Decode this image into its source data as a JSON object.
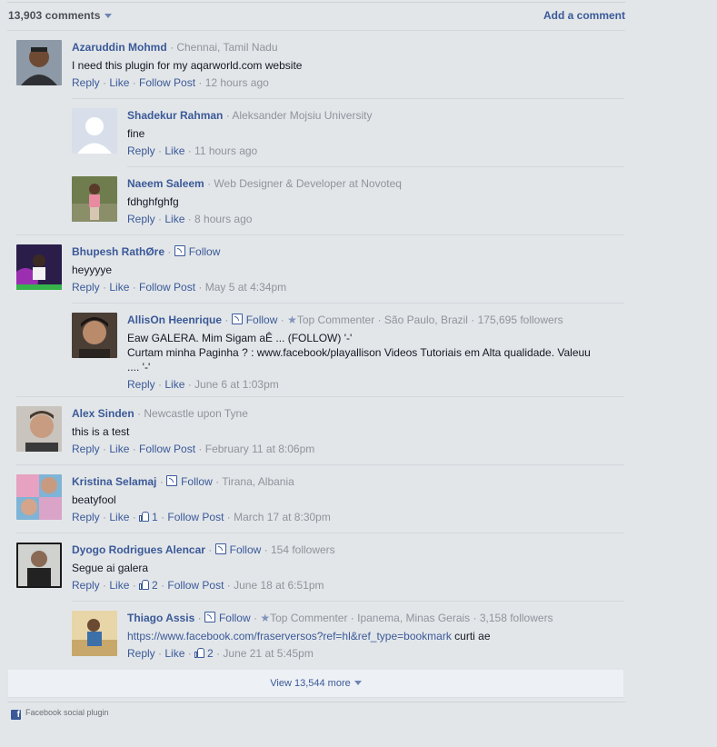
{
  "header": {
    "count": "13,903 comments",
    "add_comment": "Add a comment"
  },
  "comments": [
    {
      "name": "Azaruddin Mohmd",
      "meta": "· Chennai, Tamil Nadu",
      "text": "I need this plugin for my aqarworld.com website",
      "reply": "Reply",
      "like": "Like",
      "follow_post": "Follow Post",
      "time": "12 hours ago"
    },
    {
      "name": "Shadekur Rahman",
      "meta": "· Aleksander Mojsiu University",
      "text": "fine",
      "reply": "Reply",
      "like": "Like",
      "time": "11 hours ago"
    },
    {
      "name": "Naeem Saleem",
      "meta": "· Web Designer & Developer at Novoteq",
      "text": "fdhghfghfg",
      "reply": "Reply",
      "like": "Like",
      "time": "8 hours ago"
    },
    {
      "name": "Bhupesh RathØre",
      "follow": "Follow",
      "text": "heyyyye",
      "reply": "Reply",
      "like": "Like",
      "follow_post": "Follow Post",
      "time": "May 5 at 4:34pm"
    },
    {
      "name": "AllisOn Heenrique",
      "follow": "Follow",
      "badge": "Top Commenter",
      "meta": "· São Paulo, Brazil · 175,695 followers",
      "text1": "Eaw GALERA. Mim Sigam aÊ ... (FOLLOW) '-'",
      "text2": "Curtam minha Paginha ? : www.facebook/playallison Videos Tutoriais em Alta qualidade. Valeuu",
      "text3": ".... '-'",
      "reply": "Reply",
      "like": "Like",
      "time": "June 6 at 1:03pm"
    },
    {
      "name": "Alex Sinden",
      "meta": "· Newcastle upon Tyne",
      "text": "this is a test",
      "reply": "Reply",
      "like": "Like",
      "follow_post": "Follow Post",
      "time": "February 11 at 8:06pm"
    },
    {
      "name": "Kristina Selamaj",
      "follow": "Follow",
      "meta": "· Tirana, Albania",
      "text": "beatyfool",
      "reply": "Reply",
      "like": "Like",
      "likes": "1",
      "follow_post": "Follow Post",
      "time": "March 17 at 8:30pm"
    },
    {
      "name": "Dyogo Rodrigues Alencar",
      "follow": "Follow",
      "meta": "· 154 followers",
      "text": "Segue ai galera",
      "reply": "Reply",
      "like": "Like",
      "likes": "2",
      "follow_post": "Follow Post",
      "time": "June 18 at 6:51pm"
    },
    {
      "name": "Thiago Assis",
      "follow": "Follow",
      "badge": "Top Commenter",
      "meta": "· Ipanema, Minas Gerais · 3,158 followers",
      "link": "https://www.facebook.com/fraserversos?ref=hl&ref_type=bookmark",
      "text_after": " curti ae",
      "reply": "Reply",
      "like": "Like",
      "likes": "2",
      "time": "June 21 at 5:45pm"
    }
  ],
  "view_more": "View 13,544 more",
  "footer": "Facebook social plugin",
  "colors": {
    "link": "#3b5998",
    "meta": "#90949c",
    "background": "#e2e6e9"
  },
  "icons": [
    "caret-down-icon",
    "follow-rss-icon",
    "star-icon",
    "like-thumb-icon",
    "facebook-icon"
  ]
}
